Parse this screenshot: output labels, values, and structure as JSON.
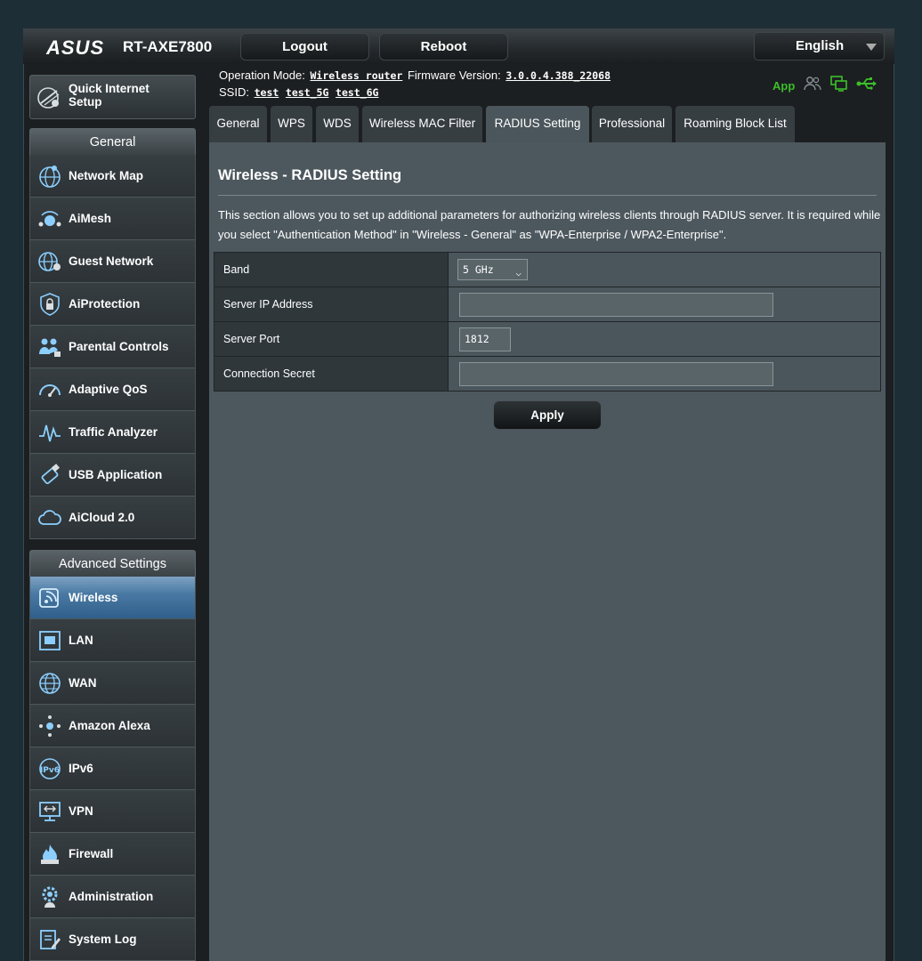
{
  "header": {
    "brand": "ASUS",
    "model": "RT-AXE7800",
    "logout_label": "Logout",
    "reboot_label": "Reboot",
    "language": "English"
  },
  "info": {
    "op_mode_label": "Operation Mode:",
    "op_mode_value": "Wireless router",
    "fw_label": "Firmware Version:",
    "fw_value": "3.0.0.4.388_22068",
    "ssid_label": "SSID:",
    "ssids": [
      "test",
      "test_5G",
      "test_6G"
    ],
    "app_label": "App"
  },
  "sidebar": {
    "qis_label": "Quick Internet Setup",
    "general_title": "General",
    "general_items": [
      {
        "label": "Network Map",
        "icon": "globe-network-icon"
      },
      {
        "label": "AiMesh",
        "icon": "aimesh-icon"
      },
      {
        "label": "Guest Network",
        "icon": "guest-globe-icon"
      },
      {
        "label": "AiProtection",
        "icon": "shield-lock-icon"
      },
      {
        "label": "Parental Controls",
        "icon": "family-lock-icon"
      },
      {
        "label": "Adaptive QoS",
        "icon": "speedometer-icon"
      },
      {
        "label": "Traffic Analyzer",
        "icon": "waveform-icon"
      },
      {
        "label": "USB Application",
        "icon": "usb-icon"
      },
      {
        "label": "AiCloud 2.0",
        "icon": "cloud-icon"
      }
    ],
    "advanced_title": "Advanced Settings",
    "advanced_items": [
      {
        "label": "Wireless",
        "icon": "wireless-icon",
        "active": true
      },
      {
        "label": "LAN",
        "icon": "lan-port-icon"
      },
      {
        "label": "WAN",
        "icon": "wan-globe-icon"
      },
      {
        "label": "Amazon Alexa",
        "icon": "alexa-icon"
      },
      {
        "label": "IPv6",
        "icon": "ipv6-icon"
      },
      {
        "label": "VPN",
        "icon": "vpn-monitor-icon"
      },
      {
        "label": "Firewall",
        "icon": "fire-icon"
      },
      {
        "label": "Administration",
        "icon": "gear-person-icon"
      },
      {
        "label": "System Log",
        "icon": "log-edit-icon"
      }
    ]
  },
  "tabs": [
    "General",
    "WPS",
    "WDS",
    "Wireless MAC Filter",
    "RADIUS Setting",
    "Professional",
    "Roaming Block List"
  ],
  "active_tab": "RADIUS Setting",
  "page": {
    "title": "Wireless - RADIUS Setting",
    "description": "This section allows you to set up additional parameters for authorizing wireless clients through RADIUS server. It is required while you select \"Authentication Method\" in \"Wireless - General\" as \"WPA-Enterprise / WPA2-Enterprise\".",
    "band_label": "Band",
    "band_value": "5 GHz",
    "server_ip_label": "Server IP Address",
    "server_ip_value": "",
    "server_port_label": "Server Port",
    "server_port_value": "1812",
    "secret_label": "Connection Secret",
    "secret_value": "",
    "apply_label": "Apply"
  },
  "colors": {
    "accent_green": "#3cbf2a",
    "active_menu": "#4a7aa4",
    "icon_blue": "#8ccfff"
  }
}
